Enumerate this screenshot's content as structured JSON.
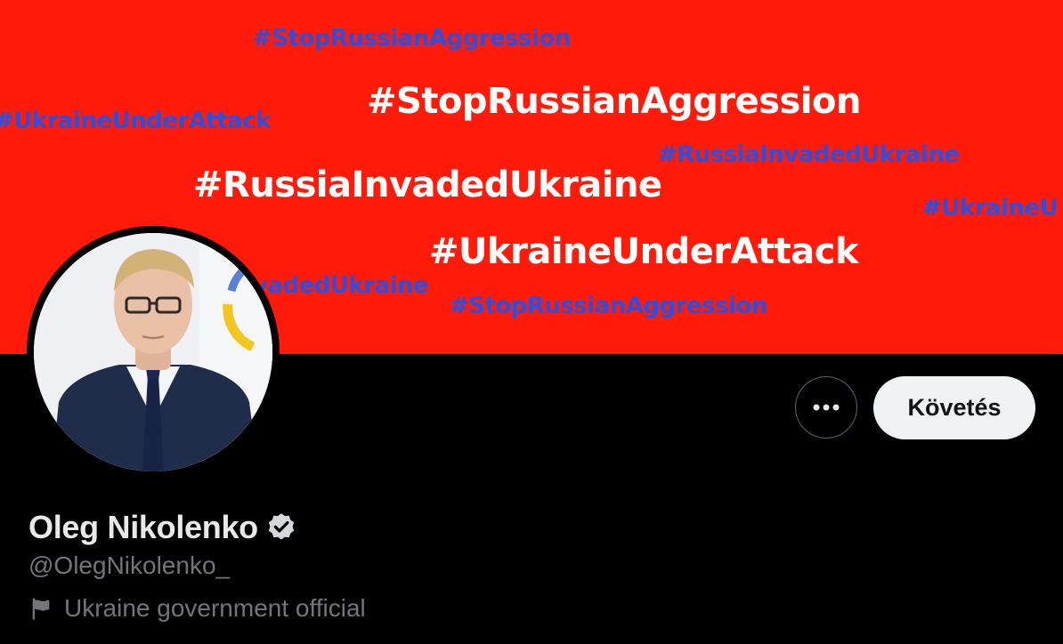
{
  "banner": {
    "background_color": "#ff1a0a",
    "hashtags": [
      "#StopRussianAggression",
      "#StopRussianAggression",
      "#UkraineUnderAttack",
      "#RussiaInvadedUkraine",
      "#RussiaInvadedUkraine",
      "#UkraineU",
      "#UkraineUnderAttack",
      "vadedUkraine",
      "#StopRussianAggression"
    ]
  },
  "profile": {
    "display_name": "Oleg Nikolenko",
    "handle": "@OlegNikolenko_",
    "verified_icon": "verified-badge-icon",
    "affiliation_icon": "flag-icon",
    "affiliation_label": "Ukraine government official"
  },
  "actions": {
    "more_icon": "more-horizontal-icon",
    "follow_label": "Követés"
  }
}
